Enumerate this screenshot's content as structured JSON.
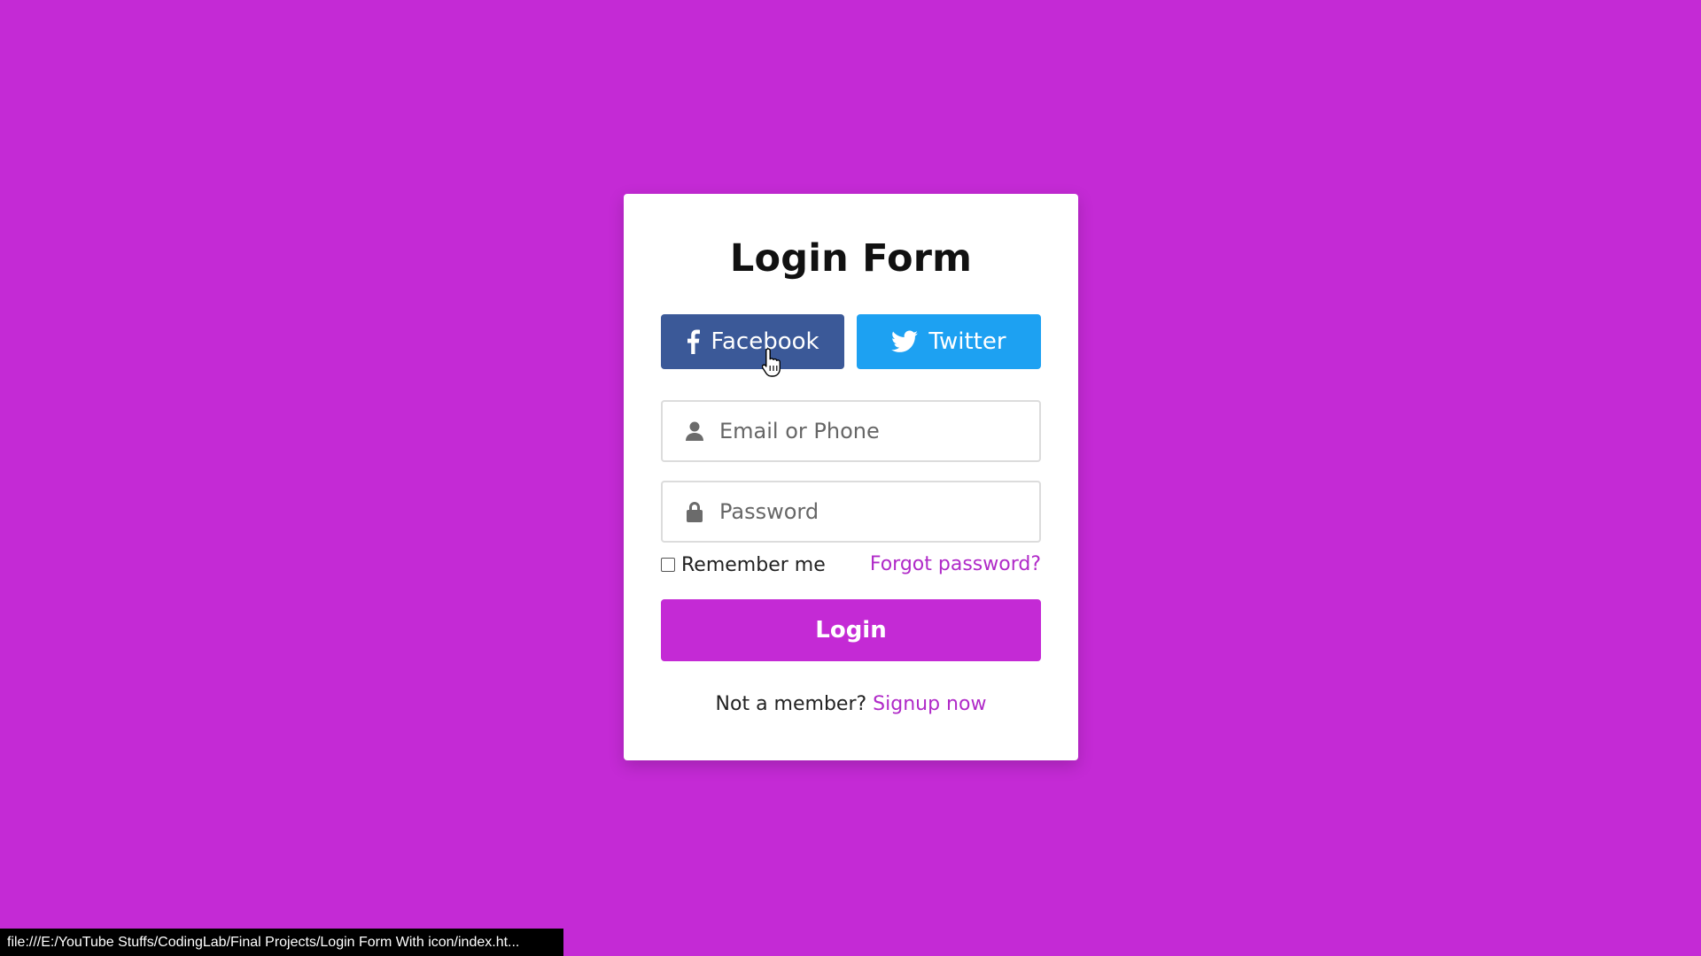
{
  "colors": {
    "background": "#c42ad5",
    "card": "#ffffff",
    "facebook": "#3b5998",
    "twitter": "#1da1f2",
    "accent_link": "#b02ac8",
    "login_button": "#c42ad5"
  },
  "form": {
    "title": "Login Form",
    "social": {
      "facebook": {
        "label": "Facebook",
        "icon": "facebook-icon"
      },
      "twitter": {
        "label": "Twitter",
        "icon": "twitter-icon"
      }
    },
    "email": {
      "placeholder": "Email or Phone",
      "value": "",
      "icon": "user-icon"
    },
    "password": {
      "placeholder": "Password",
      "value": "",
      "icon": "lock-icon"
    },
    "remember_label": "Remember me",
    "remember_checked": false,
    "forgot_label": "Forgot password?",
    "login_label": "Login",
    "signup_prompt": "Not a member?",
    "signup_link": "Signup now"
  },
  "status_bar": {
    "url": "file:///E:/YouTube Stuffs/CodingLab/Final Projects/Login Form With icon/index.ht..."
  }
}
